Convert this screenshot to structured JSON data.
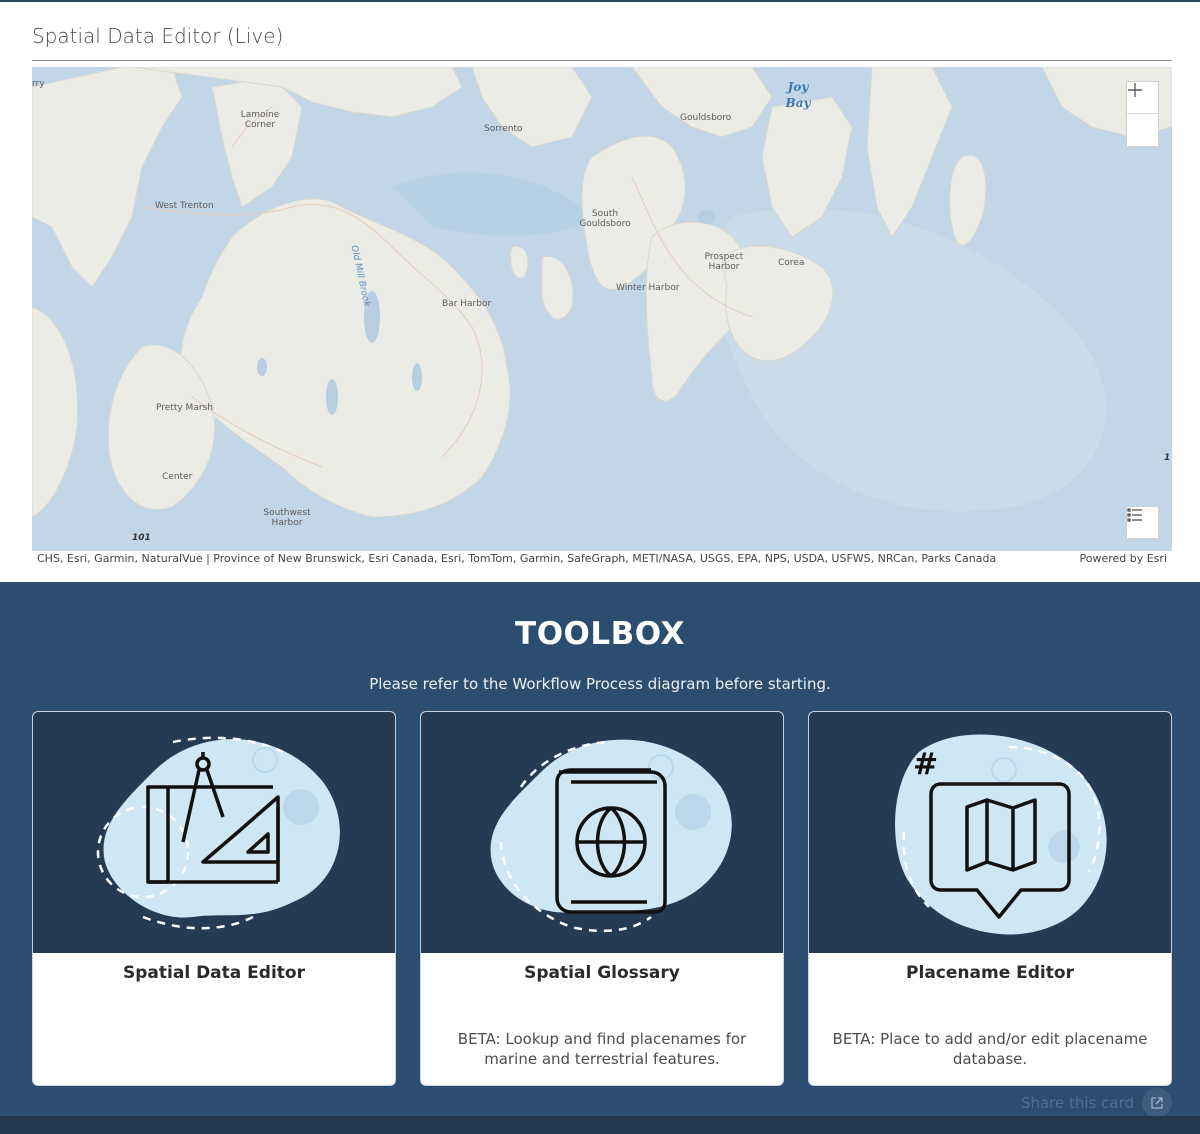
{
  "header": {
    "title": "Spatial Data Editor (Live)"
  },
  "map": {
    "labels": {
      "lamoine": "Lamoine Corner",
      "sorrento": "Sorrento",
      "gouldsboro": "Gouldsboro",
      "west_trenton": "West Trenton",
      "south_gouldsboro": "South Gouldsboro",
      "prospect_harbor": "Prospect Harbor",
      "corea": "Corea",
      "winter_harbor": "Winter Harbor",
      "bar_harbor": "Bar Harbor",
      "pretty_marsh": "Pretty Marsh",
      "center": "Center",
      "southwest_harbor": "Southwest Harbor",
      "old_mill_brook": "Old Mill Brook",
      "joy_bay": "Joy Bay",
      "edge_left": "rry",
      "route_101": "101",
      "edge_right": "1"
    },
    "zoom_in_icon": "plus-icon",
    "zoom_out_icon": "minus-icon",
    "legend_icon": "list-icon",
    "attribution": "CHS, Esri, Garmin, NaturalVue | Province of New Brunswick, Esri Canada, Esri, TomTom, Garmin, SafeGraph, METI/NASA, USGS, EPA, NPS, USDA, USFWS, NRCan, Parks Canada",
    "powered_by": "Powered by Esri",
    "colors": {
      "water": "#c2d6e8",
      "land": "#ebece6"
    }
  },
  "toolbox": {
    "title": "TOOLBOX",
    "subtitle": "Please refer to the Workflow Process diagram before starting.",
    "cards": [
      {
        "title": "Spatial Data Editor",
        "description": "",
        "icon": "drafting-tools-icon"
      },
      {
        "title": "Spatial Glossary",
        "description": "BETA: Lookup and find placenames for marine and terrestrial features.",
        "icon": "globe-book-icon"
      },
      {
        "title": "Placename Editor",
        "description": "BETA: Place to add and/or edit placename database.",
        "icon": "map-bubble-icon"
      }
    ],
    "share_label": "Share this card",
    "colors": {
      "band": "#2b4d6f",
      "card_image_bg": "#243b52",
      "blob": "#cfe6f5"
    }
  }
}
